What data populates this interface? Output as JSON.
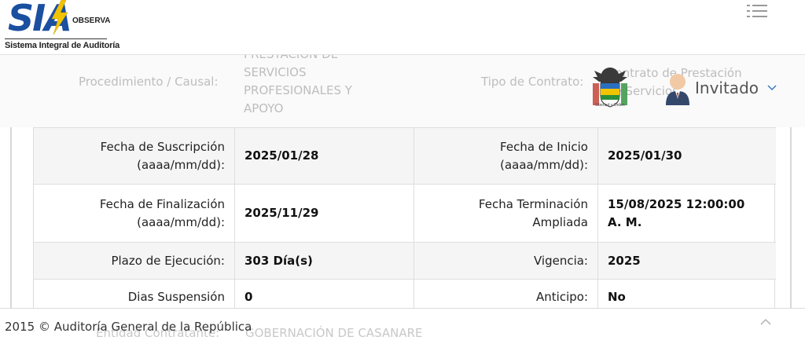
{
  "header": {
    "logo_text": "SIA",
    "logo_observa": "OBSERVA",
    "logo_subtitle": "Sistema Integral de Auditoría",
    "menu_icon": "hamburger-list-icon"
  },
  "background_row": {
    "procedure_label": "Procedimiento / Causal:",
    "procedure_value_lines": [
      "PRESTACION DE",
      "SERVICIOS",
      "PROFESIONALES Y",
      "APOYO"
    ],
    "contract_type_label": "Tipo de Contrato:",
    "contract_type_value_lines": [
      "Contrato de Prestación",
      "de Servicios"
    ]
  },
  "user": {
    "shield_caption": "Libertad y Orden",
    "name": "Invitado",
    "chevron_icon": "chevron-down-icon"
  },
  "details": [
    {
      "left_label": [
        "Fecha de Suscripción",
        "(aaaa/mm/dd):"
      ],
      "left_value": "2025/01/28",
      "right_label": [
        "Fecha de Inicio",
        "(aaaa/mm/dd):"
      ],
      "right_value": [
        "2025/01/30"
      ]
    },
    {
      "left_label": [
        "Fecha de Finalización",
        "(aaaa/mm/dd):"
      ],
      "left_value": "2025/11/29",
      "right_label": [
        "Fecha Terminación",
        "Ampliada"
      ],
      "right_value": [
        "15/08/2025 12:00:00",
        "A. M."
      ]
    },
    {
      "left_label": [
        "Plazo de Ejecución:"
      ],
      "left_value": "303 Día(s)",
      "right_label": [
        "Vigencia:"
      ],
      "right_value": [
        "2025"
      ]
    },
    {
      "left_label": [
        "Dias Suspensión"
      ],
      "left_value": "0",
      "right_label": [
        "Anticipo:"
      ],
      "right_value": [
        "No"
      ]
    }
  ],
  "footer": {
    "copyright": "2015 © Auditoría General de la República",
    "ghost_label": "Entidad Contratante:",
    "ghost_value": "GOBERNACIÓN DE CASANARE",
    "scroll_icon": "chevron-up-icon"
  },
  "colors": {
    "brand_blue": "#1b4fa0",
    "brand_yellow": "#f2c400",
    "row_alt": "#f5f5f5"
  }
}
